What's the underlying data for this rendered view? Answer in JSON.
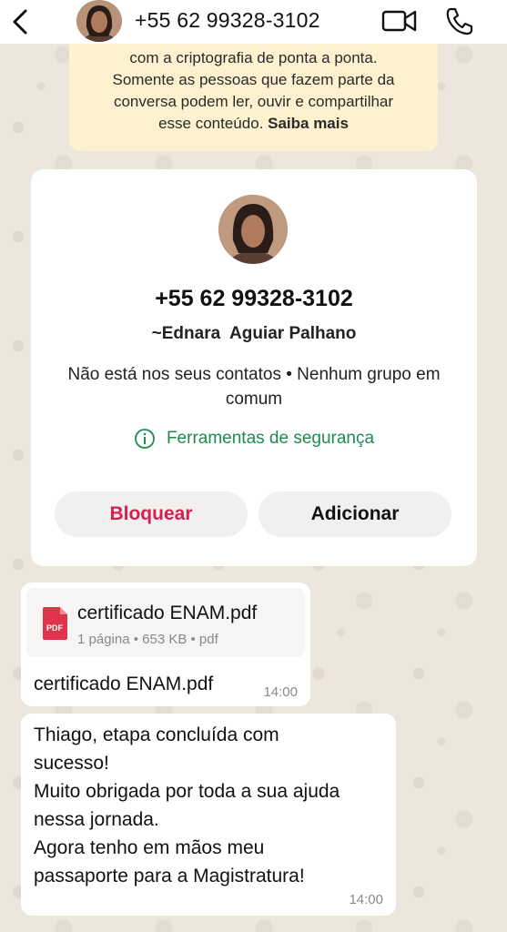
{
  "header": {
    "back_icon": "chevron-left-icon",
    "title": "+55 62 99328-3102",
    "video_icon": "video-camera-icon",
    "phone_icon": "phone-icon"
  },
  "encryption_notice": {
    "line1": "com a criptografia de ponta a ponta.",
    "line2": "Somente as pessoas que fazem parte da",
    "line3": "conversa podem ler, ouvir e compartilhar",
    "line4_text": "esse conteúdo.",
    "link": "Saiba mais"
  },
  "contact_card": {
    "phone": "+55 62 99328-3102",
    "name": "~Ednara  Aguiar Palhano",
    "info": "Não está nos seus contatos • Nenhum grupo em comum",
    "safety_tools": "Ferramentas de segurança",
    "block_label": "Bloquear",
    "add_label": "Adicionar"
  },
  "messages": [
    {
      "type": "document",
      "file_name": "certificado ENAM.pdf",
      "file_icon_label": "PDF",
      "file_meta": "1 página • 653 KB • pdf",
      "caption": "certificado ENAM.pdf",
      "time": "14:00"
    },
    {
      "type": "text",
      "lines": [
        "Thiago, etapa concluída com",
        "sucesso!",
        "Muito obrigada por toda a sua ajuda",
        "nessa jornada.",
        "Agora tenho em mãos meu",
        "passaporte para a Magistratura!"
      ],
      "time": "14:00"
    }
  ],
  "colors": {
    "wallpaper": "#efeae2",
    "notice_bg": "#fdf1cf",
    "block_red": "#d62050",
    "safety_green": "#1f8a50"
  }
}
